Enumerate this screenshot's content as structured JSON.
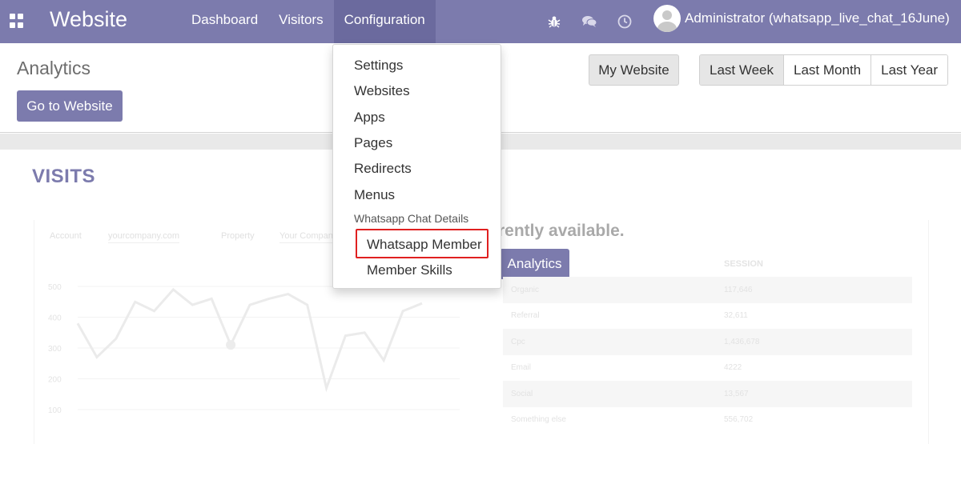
{
  "navbar": {
    "brand": "Website",
    "menu": [
      {
        "label": "Dashboard",
        "active": false
      },
      {
        "label": "Visitors",
        "active": false
      },
      {
        "label": "Configuration",
        "active": true
      }
    ],
    "systray_icons": [
      "bug-icon",
      "chat-icon",
      "clock-icon"
    ],
    "user_name": "Administrator (whatsapp_live_chat_16June)"
  },
  "control_panel": {
    "title": "Analytics",
    "goto_label": "Go to Website",
    "my_website_label": "My Website",
    "ranges": [
      {
        "label": "Last Week",
        "active": true
      },
      {
        "label": "Last Month",
        "active": false
      },
      {
        "label": "Last Year",
        "active": false
      }
    ]
  },
  "main": {
    "visits_title": "VISITS",
    "notice": "rently available.",
    "analytics_button": "Analytics",
    "faded_filters": [
      "Account",
      "yourcompany.com",
      "Property",
      "Your Company"
    ],
    "y_ticks": [
      "500",
      "400",
      "300",
      "200",
      "100"
    ],
    "chart_values": [
      380,
      270,
      330,
      450,
      420,
      490,
      440,
      460,
      310,
      440,
      460,
      475,
      440,
      170,
      340,
      350,
      260,
      420,
      445
    ],
    "session_header": "SESSION",
    "table": [
      {
        "source": "Organic",
        "value": "117,646"
      },
      {
        "source": "Referral",
        "value": "32,611"
      },
      {
        "source": "Cpc",
        "value": "1,436,678"
      },
      {
        "source": "Email",
        "value": "4222"
      },
      {
        "source": "Social",
        "value": "13,567"
      },
      {
        "source": "Something else",
        "value": "556,702"
      }
    ]
  },
  "dropdown": {
    "items": [
      "Settings",
      "Websites",
      "Apps",
      "Pages",
      "Redirects",
      "Menus"
    ],
    "section_header": "Whatsapp Chat Details",
    "sub_items": [
      "Whatsapp Member",
      "Member Skills"
    ],
    "highlighted": "Whatsapp Member",
    "highlight_color": "#e02020"
  },
  "colors": {
    "brand": "#7c7bad",
    "active_nav": "#6b6a9e"
  }
}
